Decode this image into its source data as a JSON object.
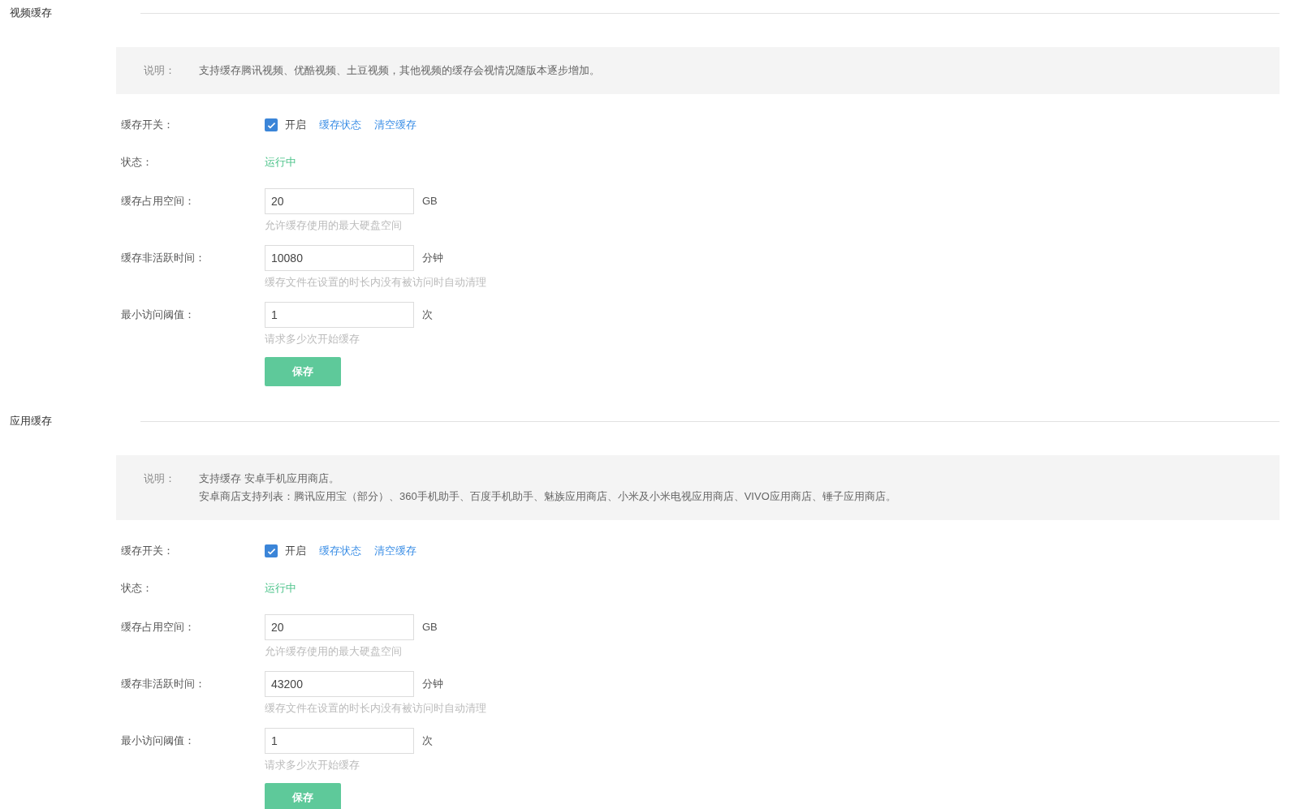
{
  "sections": [
    {
      "title": "视频缓存",
      "note": {
        "label": "说明：",
        "lines": [
          "支持缓存腾讯视频、优酷视频、土豆视频，其他视频的缓存会视情况随版本逐步增加。"
        ]
      },
      "switch": {
        "label": "缓存开关：",
        "checked": true,
        "text": "开启",
        "links": [
          "缓存状态",
          "清空缓存"
        ]
      },
      "status": {
        "label": "状态：",
        "value": "运行中"
      },
      "fields": [
        {
          "label": "缓存占用空间：",
          "value": "20",
          "unit": "GB",
          "hint": "允许缓存使用的最大硬盘空间"
        },
        {
          "label": "缓存非活跃时间：",
          "value": "10080",
          "unit": "分钟",
          "hint": "缓存文件在设置的时长内没有被访问时自动清理"
        },
        {
          "label": "最小访问阈值：",
          "value": "1",
          "unit": "次",
          "hint": "请求多少次开始缓存"
        }
      ],
      "save_button": "保存"
    },
    {
      "title": "应用缓存",
      "note": {
        "label": "说明：",
        "lines": [
          "支持缓存 安卓手机应用商店。",
          "安卓商店支持列表：腾讯应用宝（部分）、360手机助手、百度手机助手、魅族应用商店、小米及小米电视应用商店、VIVO应用商店、锤子应用商店。"
        ]
      },
      "switch": {
        "label": "缓存开关：",
        "checked": true,
        "text": "开启",
        "links": [
          "缓存状态",
          "清空缓存"
        ]
      },
      "status": {
        "label": "状态：",
        "value": "运行中"
      },
      "fields": [
        {
          "label": "缓存占用空间：",
          "value": "20",
          "unit": "GB",
          "hint": "允许缓存使用的最大硬盘空间"
        },
        {
          "label": "缓存非活跃时间：",
          "value": "43200",
          "unit": "分钟",
          "hint": "缓存文件在设置的时长内没有被访问时自动清理"
        },
        {
          "label": "最小访问阈值：",
          "value": "1",
          "unit": "次",
          "hint": "请求多少次开始缓存"
        }
      ],
      "save_button": "保存"
    }
  ]
}
